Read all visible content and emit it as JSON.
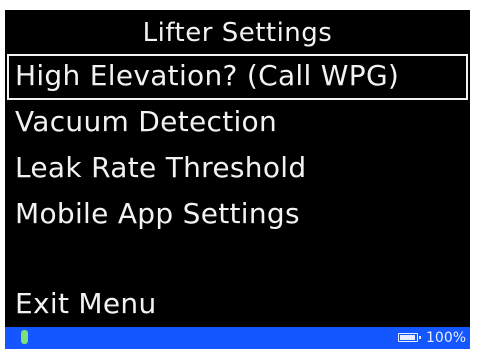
{
  "screen": {
    "title": "Lifter Settings",
    "menu": [
      {
        "label": "High Elevation? (Call WPG)",
        "selected": true
      },
      {
        "label": "Vacuum Detection",
        "selected": false
      },
      {
        "label": "Leak Rate Threshold",
        "selected": false
      },
      {
        "label": "Mobile App Settings",
        "selected": false
      }
    ],
    "exit_label": "Exit Menu"
  },
  "status_bar": {
    "icon": "mobile-app-icon",
    "battery_icon": "battery-icon",
    "battery_text": "100%",
    "battery_level": 1.0
  },
  "colors": {
    "background": "#000000",
    "text": "#f2f2f2",
    "status_bar": "#1456ff",
    "app_icon": "#7ee07a"
  }
}
